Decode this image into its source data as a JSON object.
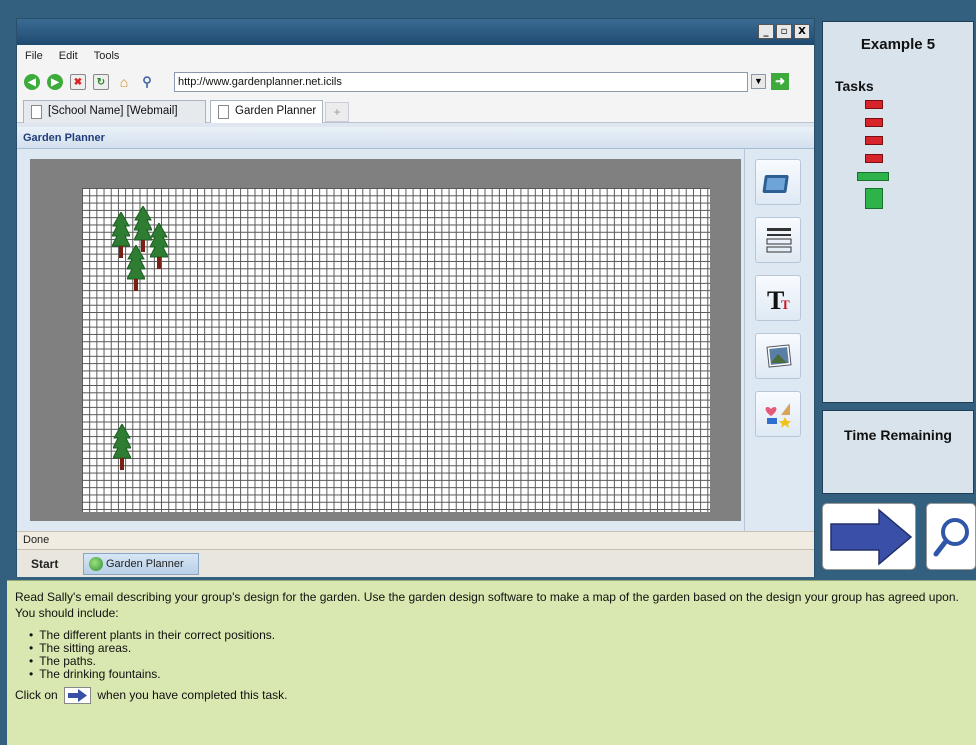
{
  "browser": {
    "menu": [
      "File",
      "Edit",
      "Tools"
    ],
    "url": "http://www.gardenplanner.net.icils",
    "tabs": [
      {
        "label": "[School Name] [Webmail]"
      },
      {
        "label": "Garden Planner"
      }
    ],
    "new_tab_label": "+",
    "window_buttons": [
      "_",
      "▫",
      "X"
    ]
  },
  "app": {
    "title": "Garden Planner",
    "status": "Done",
    "taskbar_start": "Start",
    "taskbar_item": "Garden Planner",
    "tools": [
      "canvas-tool",
      "list-tool",
      "text-tool",
      "image-tool",
      "shapes-tool"
    ]
  },
  "side": {
    "example_title": "Example 5",
    "tasks_label": "Tasks",
    "time_label": "Time Remaining",
    "task_states": [
      "incomplete",
      "incomplete",
      "incomplete",
      "incomplete",
      "current",
      "pending"
    ]
  },
  "instructions": {
    "paragraph": "Read Sally's email describing your group's design for the garden. Use the garden design software to make a map of the garden based on the design your group has agreed upon. You should include:",
    "items": [
      "The different plants in their correct positions.",
      "The sitting areas.",
      "The paths.",
      "The drinking fountains."
    ],
    "click_prefix": "Click on",
    "click_suffix": "when you have completed this task."
  },
  "colors": {
    "task_red": "#d7232a",
    "task_green": "#2db34a",
    "arrow_blue": "#3a4fa8",
    "instructions_bg": "#d9e7b0"
  }
}
